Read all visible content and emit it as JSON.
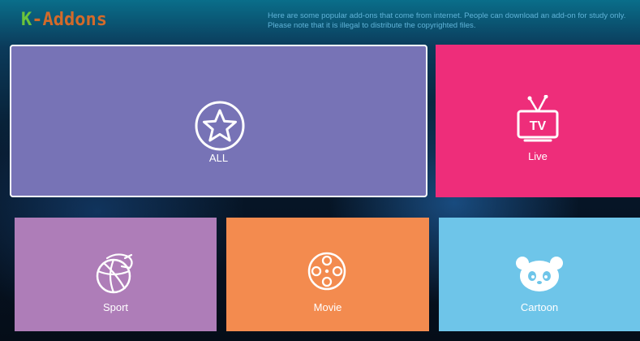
{
  "app": {
    "logo_k": "K",
    "logo_dash": "-",
    "logo_rest": "Addons",
    "notice": "Here are some popular add-ons that come from internet. People can download an add-on for study only. Please note that it is illegal to distribute the copyrighted files."
  },
  "tiles": [
    {
      "label": "ALL",
      "icon": "star-icon",
      "color": "#7773b6",
      "selected": true
    },
    {
      "label": "Live",
      "icon": "tv-icon",
      "color": "#ee2d7a"
    },
    {
      "label": "Sport",
      "icon": "basketball-icon",
      "color": "#ae7db8"
    },
    {
      "label": "Movie",
      "icon": "film-reel-icon",
      "color": "#f38b4f"
    },
    {
      "label": "Cartoon",
      "icon": "panda-icon",
      "color": "#6ec5e9"
    }
  ],
  "tv_icon_text": "TV"
}
